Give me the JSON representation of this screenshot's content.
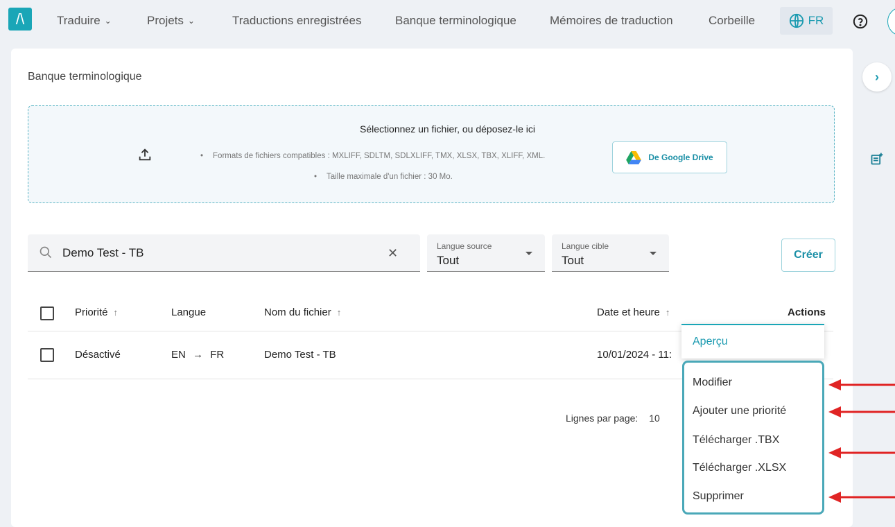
{
  "nav": {
    "items": [
      {
        "label": "Traduire",
        "dropdown": true
      },
      {
        "label": "Projets",
        "dropdown": true
      },
      {
        "label": "Traductions enregistrées"
      },
      {
        "label": "Banque terminologique"
      },
      {
        "label": "Mémoires de traduction"
      },
      {
        "label": "Corbeille"
      }
    ],
    "language": "FR",
    "logo_glyph": "/\\"
  },
  "page": {
    "title": "Banque terminologique"
  },
  "dropzone": {
    "title": "Sélectionnez un fichier, ou déposez-le ici",
    "formats": "Formats de fichiers compatibles : MXLIFF, SDLTM, SDLXLIFF, TMX, XLSX, TBX, XLIFF, XML.",
    "max_size": "Taille maximale d'un fichier : 30 Mo.",
    "gdrive_label": "De Google Drive"
  },
  "filters": {
    "search_value": "Demo Test - TB",
    "source": {
      "label": "Langue source",
      "value": "Tout"
    },
    "target": {
      "label": "Langue cible",
      "value": "Tout"
    },
    "create_label": "Créer"
  },
  "table": {
    "headers": {
      "priority": "Priorité",
      "language": "Langue",
      "filename": "Nom du fichier",
      "datetime": "Date et heure",
      "actions": "Actions"
    },
    "rows": [
      {
        "priority": "Désactivé",
        "lang_from": "EN",
        "lang_to": "FR",
        "filename": "Demo Test - TB",
        "datetime": "10/01/2024 - 11:"
      }
    ]
  },
  "pagination": {
    "rows_per_page_label": "Lignes par page:",
    "rows_per_page_value": "10"
  },
  "menu": {
    "items": [
      "Aperçu",
      "Modifier",
      "Ajouter une priorité",
      "Télécharger .TBX",
      "Télécharger .XLSX",
      "Supprimer"
    ]
  },
  "colors": {
    "accent": "#1aa6b7",
    "annotation": "#e02424"
  }
}
